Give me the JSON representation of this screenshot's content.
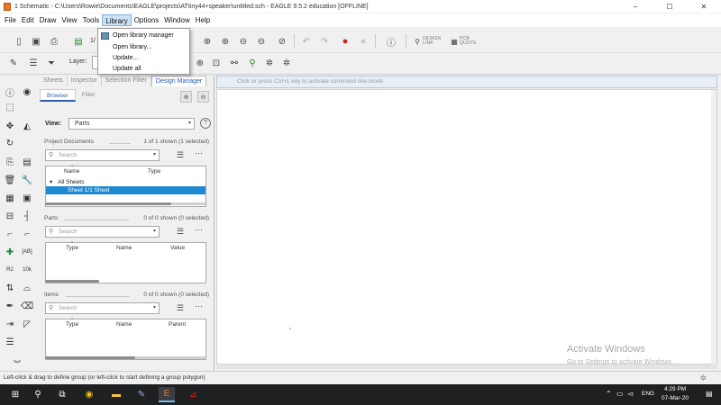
{
  "window": {
    "title": "1 Schematic - C:\\Users\\Rowie\\Documents\\EAGLE\\projects\\ATtiny44+speaker\\untitled.sch - EAGLE 9.5.2 education [OFFLINE]",
    "minimize": "–",
    "maximize": "☐",
    "close": "✕"
  },
  "menubar": {
    "items": [
      "File",
      "Edit",
      "Draw",
      "View",
      "Tools",
      "Library",
      "Options",
      "Window",
      "Help"
    ],
    "active": "Library"
  },
  "library_menu": {
    "items": [
      "Open library manager",
      "Open library...",
      "Update...",
      "Update all"
    ]
  },
  "toolbar": {
    "layer_label": "Layer:",
    "grid_value": "1/",
    "design_link": "DESIGN\nLINK",
    "pcb_quote": "PCB\nQUOTE"
  },
  "panel": {
    "tabs": [
      "Sheets",
      "Inspector",
      "Selection Filter",
      "Design Manager"
    ],
    "active_tab": "Design Manager",
    "subtabs": [
      "Browser",
      "Filter"
    ],
    "active_subtab": "Browser",
    "view_label": "View:",
    "view_value": "Parts",
    "help": "?",
    "project_documents": {
      "title": "Project Documents",
      "count": "1 of 1 shown (1 selected)",
      "search_placeholder": "Search",
      "columns": [
        "Name",
        "Type"
      ],
      "group": "All Sheets",
      "selected_row": "Sheet 1/1 Sheet"
    },
    "parts": {
      "title": "Parts",
      "count": "0 of 0 shown (0 selected)",
      "search_placeholder": "Search",
      "columns": [
        "Type",
        "Name",
        "Value"
      ]
    },
    "items": {
      "title": "Items",
      "count": "0 of 0 shown (0 selected)",
      "search_placeholder": "Search",
      "columns": [
        "Type",
        "Name",
        "Parent"
      ]
    }
  },
  "command_line": {
    "placeholder": "Click or press Ctrl+L key to activate command line mode"
  },
  "watermark": {
    "line1": "Activate Windows",
    "line2": "Go to Settings to activate Windows."
  },
  "status_bar": {
    "text": "Left-click & drag to define group (or left-click to start defining a group polygon)"
  },
  "taskbar": {
    "language": "ENG",
    "time": "4:29 PM",
    "date": "07-Mar-20"
  }
}
